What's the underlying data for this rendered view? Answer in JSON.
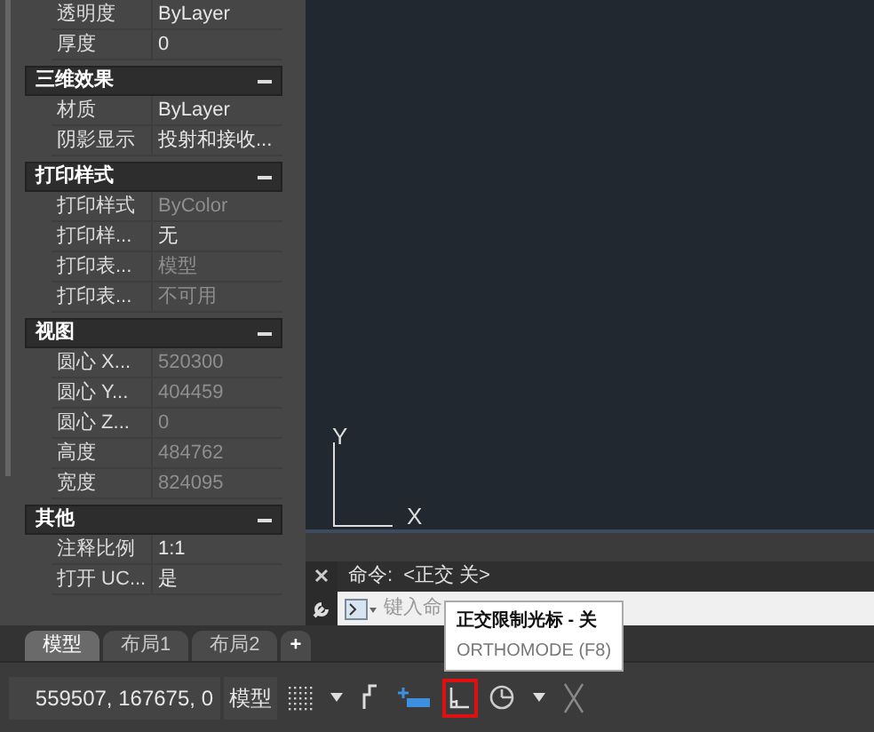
{
  "properties": {
    "sections": [
      {
        "rows": [
          {
            "label": "透明度",
            "value": "ByLayer",
            "disabled": false
          },
          {
            "label": "厚度",
            "value": "0",
            "disabled": false
          }
        ]
      },
      {
        "title": "三维效果",
        "expanded": true,
        "rows": [
          {
            "label": "材质",
            "value": "ByLayer",
            "disabled": false
          },
          {
            "label": "阴影显示",
            "value": "投射和接收...",
            "disabled": false
          }
        ]
      },
      {
        "title": "打印样式",
        "expanded": true,
        "rows": [
          {
            "label": "打印样式",
            "value": "ByColor",
            "disabled": true
          },
          {
            "label": "打印样...",
            "value": "无",
            "disabled": false
          },
          {
            "label": "打印表...",
            "value": "模型",
            "disabled": true
          },
          {
            "label": "打印表...",
            "value": "不可用",
            "disabled": true
          }
        ]
      },
      {
        "title": "视图",
        "expanded": true,
        "rows": [
          {
            "label": "圆心 X...",
            "value": "520300",
            "disabled": true
          },
          {
            "label": "圆心 Y...",
            "value": "404459",
            "disabled": true
          },
          {
            "label": "圆心 Z...",
            "value": "0",
            "disabled": true
          },
          {
            "label": "高度",
            "value": "484762",
            "disabled": true
          },
          {
            "label": "宽度",
            "value": "824095",
            "disabled": true
          }
        ]
      },
      {
        "title": "其他",
        "expanded": true,
        "rows": [
          {
            "label": "注释比例",
            "value": "1:1",
            "disabled": false
          },
          {
            "label": "打开 UC...",
            "value": "是",
            "disabled": false
          }
        ]
      }
    ]
  },
  "ucs": {
    "x_label": "X",
    "y_label": "Y"
  },
  "command_line": {
    "history_label": "命令:",
    "history_value": "<正交 关>",
    "placeholder": "键入命"
  },
  "layout_tabs": [
    {
      "label": "模型",
      "selected": true
    },
    {
      "label": "布局1",
      "selected": false
    },
    {
      "label": "布局2",
      "selected": false
    }
  ],
  "add_tab": "+",
  "tooltip": {
    "title": "正交限制光标 - 关",
    "subtitle": "ORTHOMODE (F8)"
  },
  "status_bar": {
    "coordinates": "559507, 167675, 0",
    "space_button": "模型",
    "tools": [
      {
        "kind": "grid",
        "highlighted": false
      },
      {
        "kind": "dropdown",
        "highlighted": false
      },
      {
        "kind": "snap",
        "highlighted": false
      },
      {
        "kind": "infer",
        "highlighted": false
      },
      {
        "kind": "ortho",
        "highlighted": true
      },
      {
        "kind": "polar",
        "highlighted": false
      },
      {
        "kind": "dropdown",
        "highlighted": false
      },
      {
        "kind": "isodraft",
        "highlighted": false
      }
    ]
  }
}
